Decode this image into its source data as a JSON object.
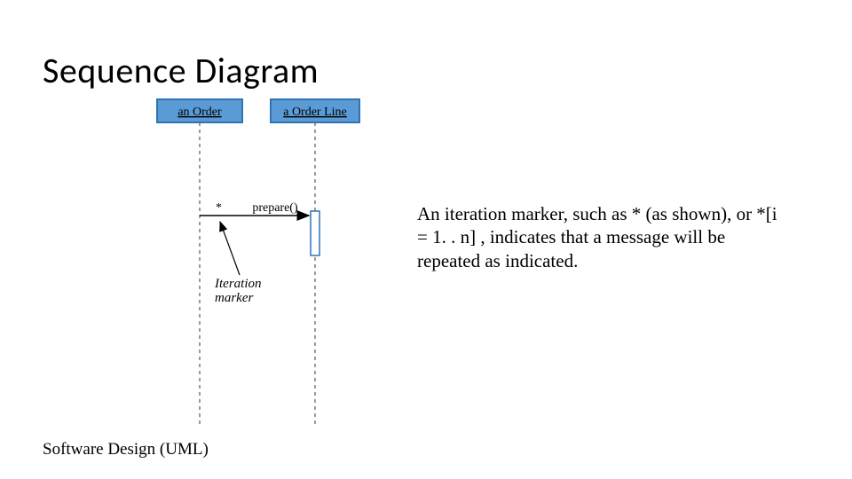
{
  "title": "Sequence Diagram",
  "footer": "Software Design (UML)",
  "objects": [
    {
      "label": "an Order"
    },
    {
      "label": "a Order Line"
    }
  ],
  "message": {
    "marker": "*",
    "label": "prepare()"
  },
  "annotation": {
    "line1": "Iteration",
    "line2": "marker"
  },
  "explain": "An iteration marker, such as * (as shown), or  *[i = 1. . n]  , indicates that a message will be repeated as indicated.",
  "colors": {
    "box_fill": "#5b9bd5",
    "box_stroke": "#2e74b5"
  }
}
